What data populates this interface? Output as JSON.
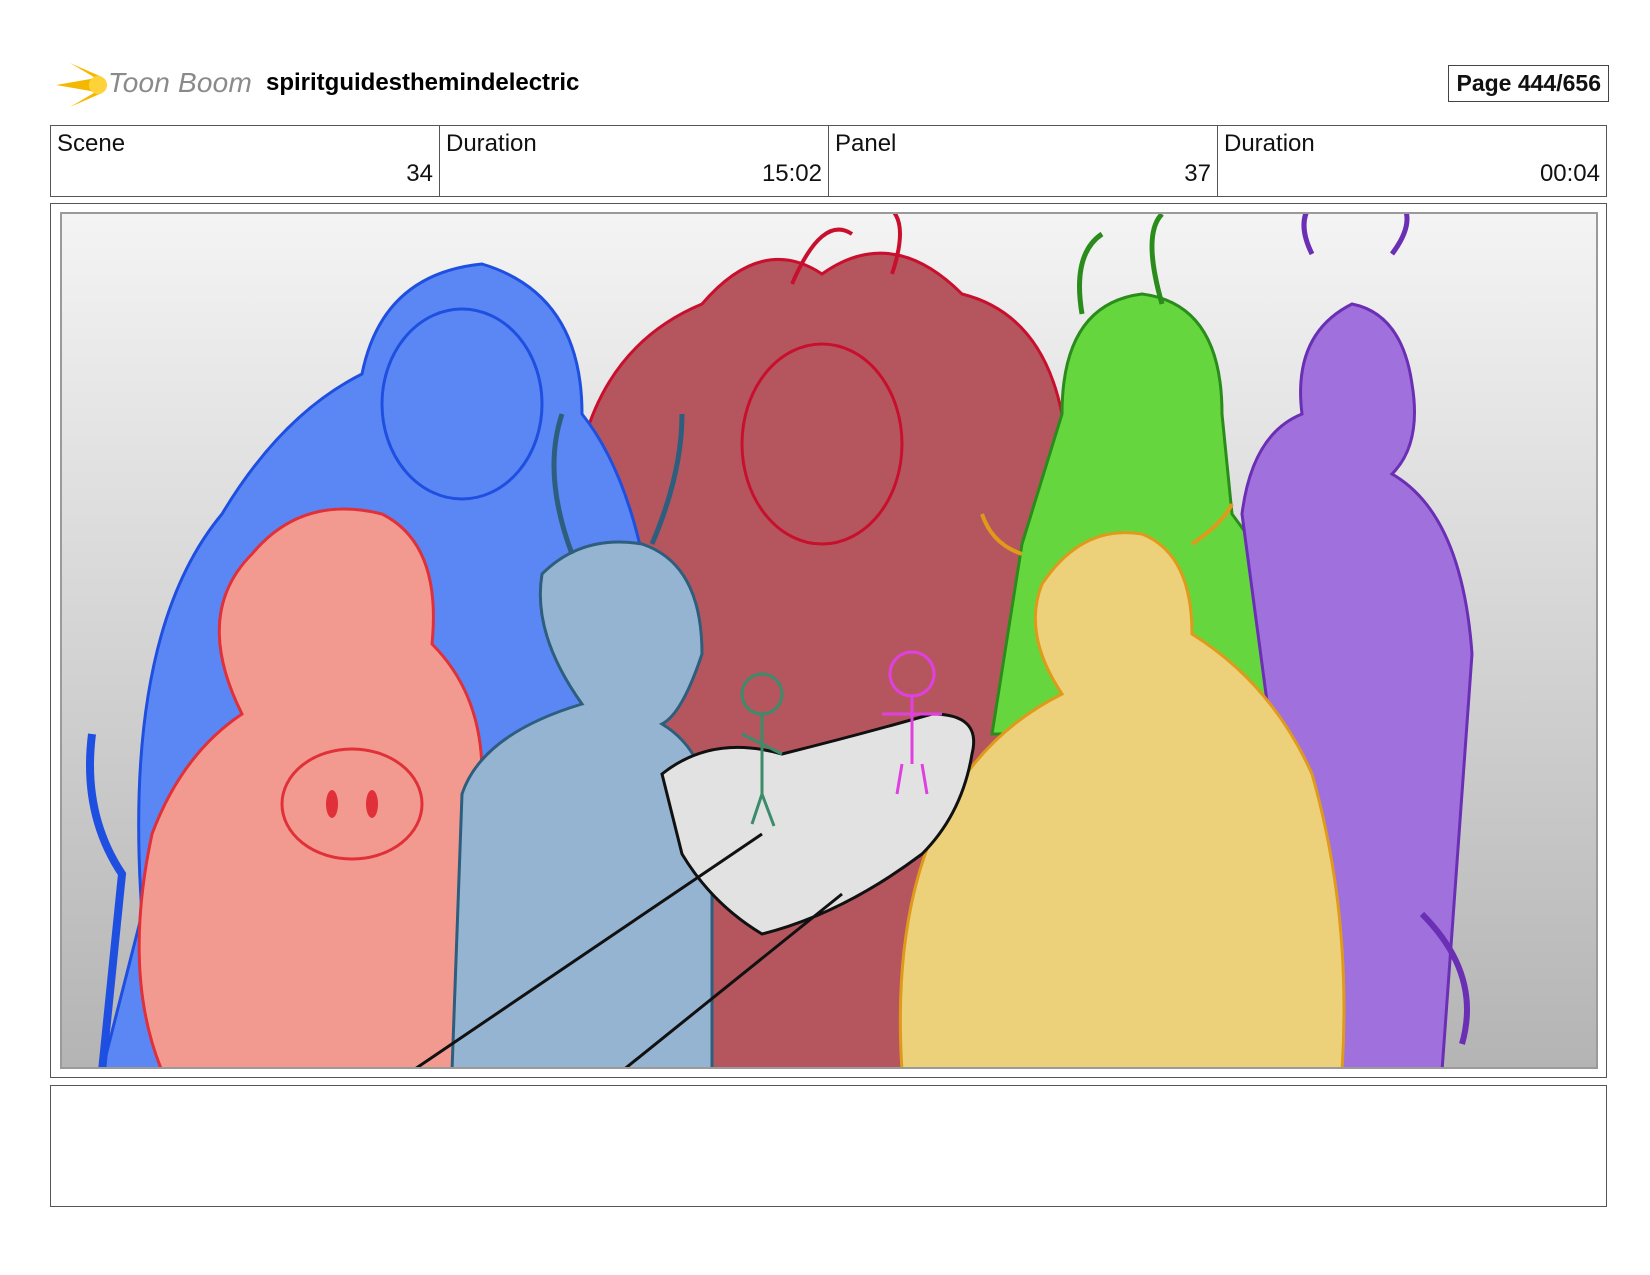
{
  "header": {
    "logo_text": "Toon Boom",
    "project_title": "spiritguidesthemindelectric",
    "page_label": "Page 444/656"
  },
  "info": {
    "scene_label": "Scene",
    "scene_value": "34",
    "scene_duration_label": "Duration",
    "scene_duration_value": "15:02",
    "panel_label": "Panel",
    "panel_value": "37",
    "panel_duration_label": "Duration",
    "panel_duration_value": "00:04"
  },
  "colors": {
    "logo_yellow": "#f5b800",
    "blue_character": "#5b87f5",
    "red_character": "#b5565f",
    "green_character": "#66d63f",
    "purple_character": "#a070dc",
    "pink_character": "#f39a90",
    "steel_blue_character": "#95b4d2",
    "yellow_character": "#ecd07a"
  },
  "notes": ""
}
